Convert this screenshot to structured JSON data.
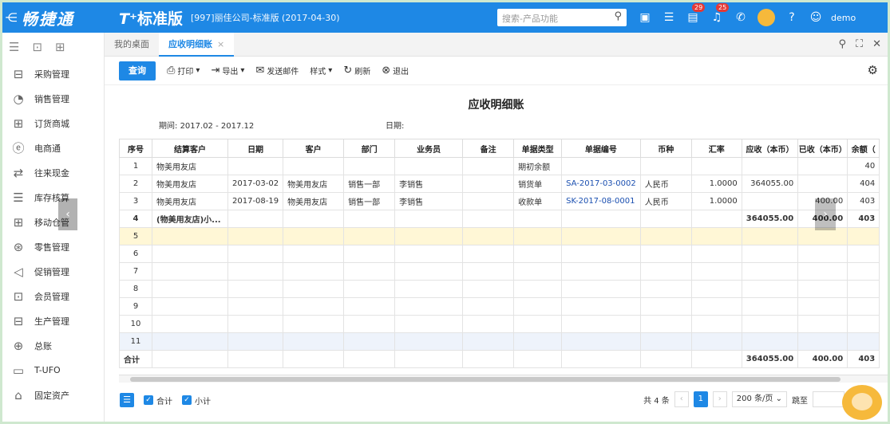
{
  "app": {
    "brand": "畅捷通",
    "product_prefix": "T⁺",
    "product_name": "标准版",
    "company": "[997]丽佳公司-标准版 (2017-04-30)",
    "search_placeholder": "搜索-产品功能",
    "badge_a": "29",
    "badge_b": "25",
    "user": "demo"
  },
  "sidebar": {
    "items": [
      {
        "label": "采购管理"
      },
      {
        "label": "销售管理"
      },
      {
        "label": "订货商城"
      },
      {
        "label": "电商通"
      },
      {
        "label": "往来现金"
      },
      {
        "label": "库存核算"
      },
      {
        "label": "移动仓管"
      },
      {
        "label": "零售管理"
      },
      {
        "label": "促销管理"
      },
      {
        "label": "会员管理"
      },
      {
        "label": "生产管理"
      },
      {
        "label": "总账"
      },
      {
        "label": "T-UFO"
      },
      {
        "label": "固定资产"
      }
    ]
  },
  "tabs": {
    "home": "我的桌面",
    "active": "应收明细账"
  },
  "toolbar": {
    "query": "查询",
    "print": "打印",
    "export": "导出",
    "email": "发送邮件",
    "style": "样式",
    "refresh": "刷新",
    "exit": "退出"
  },
  "report": {
    "title": "应收明细账",
    "period_label": "期间:",
    "period_value": "2017.02 - 2017.12",
    "date_label": "日期:",
    "columns": [
      "序号",
      "结算客户",
      "日期",
      "客户",
      "部门",
      "业务员",
      "备注",
      "单据类型",
      "单据编号",
      "币种",
      "汇率",
      "应收（本币）",
      "已收（本币）",
      "余额（"
    ],
    "rows": [
      [
        "1",
        "物美用友店",
        "",
        "",
        "",
        "",
        "",
        "期初余额",
        "",
        "",
        "",
        "",
        "",
        "40"
      ],
      [
        "2",
        "物美用友店",
        "2017-03-02",
        "物美用友店",
        "销售一部",
        "李销售",
        "",
        "销货单",
        "SA-2017-03-0002",
        "人民币",
        "1.0000",
        "364055.00",
        "",
        "404"
      ],
      [
        "3",
        "物美用友店",
        "2017-08-19",
        "物美用友店",
        "销售一部",
        "李销售",
        "",
        "收款单",
        "SK-2017-08-0001",
        "人民币",
        "1.0000",
        "",
        "400.00",
        "403"
      ],
      [
        "4",
        "(物美用友店)小...",
        "",
        "",
        "",
        "",
        "",
        "",
        "",
        "",
        "",
        "364055.00",
        "400.00",
        "403"
      ],
      [
        "5",
        "",
        "",
        "",
        "",
        "",
        "",
        "",
        "",
        "",
        "",
        "",
        "",
        ""
      ],
      [
        "6",
        "",
        "",
        "",
        "",
        "",
        "",
        "",
        "",
        "",
        "",
        "",
        "",
        ""
      ],
      [
        "7",
        "",
        "",
        "",
        "",
        "",
        "",
        "",
        "",
        "",
        "",
        "",
        "",
        ""
      ],
      [
        "8",
        "",
        "",
        "",
        "",
        "",
        "",
        "",
        "",
        "",
        "",
        "",
        "",
        ""
      ],
      [
        "9",
        "",
        "",
        "",
        "",
        "",
        "",
        "",
        "",
        "",
        "",
        "",
        "",
        ""
      ],
      [
        "10",
        "",
        "",
        "",
        "",
        "",
        "",
        "",
        "",
        "",
        "",
        "",
        "",
        ""
      ],
      [
        "11",
        "",
        "",
        "",
        "",
        "",
        "",
        "",
        "",
        "",
        "",
        "",
        "",
        ""
      ]
    ],
    "total": [
      "合计",
      "",
      "",
      "",
      "",
      "",
      "",
      "",
      "",
      "",
      "",
      "364055.00",
      "400.00",
      "403"
    ]
  },
  "footer": {
    "total_check": "合计",
    "subtotal_check": "小计",
    "count": "共 4 条",
    "current_page": "1",
    "page_size": "200 条/页",
    "goto": "跳至"
  },
  "colors": {
    "primary": "#1e88e5",
    "subtotal_row": "#fff7d6",
    "selected_row": "#eef3fb"
  }
}
